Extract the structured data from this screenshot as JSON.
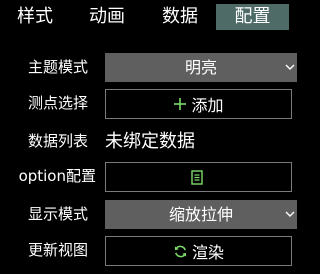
{
  "tabs": [
    {
      "label": "样式"
    },
    {
      "label": "动画"
    },
    {
      "label": "数据"
    },
    {
      "label": "配置",
      "active": true
    }
  ],
  "rows": {
    "theme_mode": {
      "label": "主题模式",
      "value": "明亮"
    },
    "point_select": {
      "label": "测点选择",
      "button": "添加"
    },
    "data_list": {
      "label": "数据列表",
      "value": "未绑定数据"
    },
    "option_config": {
      "label": "option配置"
    },
    "display_mode": {
      "label": "显示模式",
      "value": "缩放拉伸"
    },
    "refresh_view": {
      "label": "更新视图",
      "button": "渲染"
    }
  },
  "colors": {
    "accent_green": "#7ddb6a",
    "active_tab": "#4e6b68",
    "select_bg": "#5f5f5f"
  }
}
